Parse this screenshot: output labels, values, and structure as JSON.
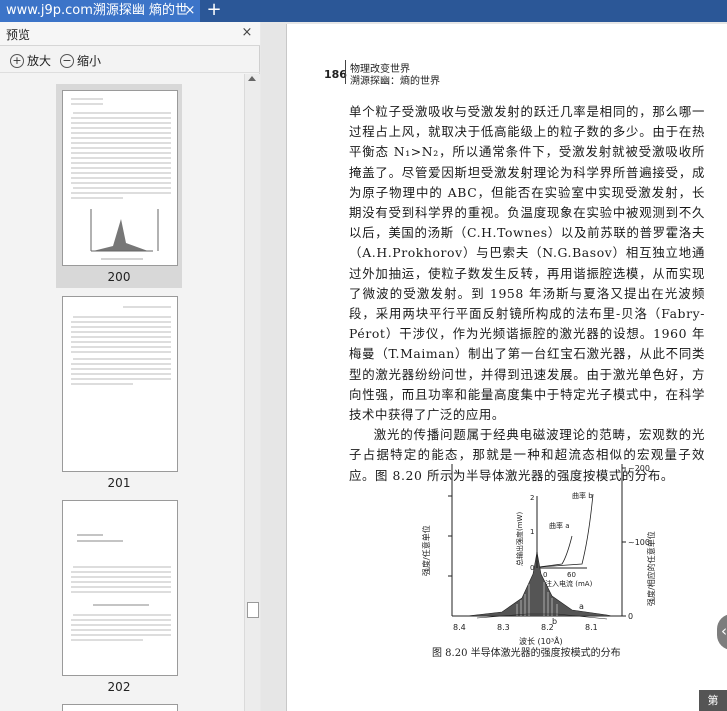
{
  "tab": {
    "title": "www.j9p.com溯源探幽  熵的世",
    "close": "×",
    "add": "+"
  },
  "sidebar": {
    "title": "预览",
    "close": "×",
    "zoom_in_label": "放大",
    "zoom_out_label": "缩小",
    "thumbnails": [
      {
        "label": "200",
        "selected": true
      },
      {
        "label": "201",
        "selected": false
      },
      {
        "label": "202",
        "selected": false
      }
    ]
  },
  "page": {
    "number": "186",
    "header_line1": "物理改变世界",
    "header_line2": "溯源探幽：熵的世界",
    "paragraphs": [
      "单个粒子受激吸收与受激发射的跃迁几率是相同的，那么哪一过程占上风，就取决于低高能级上的粒子数的多少。由于在热平衡态 N₁>N₂，所以通常条件下，受激发射就被受激吸收所掩盖了。尽管爱因斯坦受激发射理论为科学界所普遍接受，成为原子物理中的 ABC，但能否在实验室中实现受激发射，长期没有受到科学界的重视。负温度现象在实验中被观测到不久以后，美国的汤斯（C.H.Townes）以及前苏联的普罗霍洛夫（A.H.Prokhorov）与巴索夫（N.G.Basov）相互独立地通过外加抽运，使粒子数发生反转，再用谐振腔选模，从而实现了微波的受激发射。到 1958 年汤斯与夏洛又提出在光波频段，采用两块平行平面反射镜所构成的法布里-贝洛（Fabry-Pérot）干涉仪，作为光频谐振腔的激光器的设想。1960 年梅曼（T.Maiman）制出了第一台红宝石激光器，从此不同类型的激光器纷纷问世，并得到迅速发展。由于激光单色好，方向性强，而且功率和能量高度集中于特定光子模式中，在科学技术中获得了广泛的应用。",
      "激光的传播问题属于经典电磁波理论的范畴，宏观数的光子占据特定的能态，那就是一种和超流态相似的宏观量子效应。图 8.20 所示为半导体激光器的强度按模式的分布。"
    ],
    "figure": {
      "left_axis_label": "强度/任意单位",
      "right_axis_label": "强度/相应的任意单位",
      "inset_y_label": "总输出强度(mW)",
      "inset_x_label": "注入电流 (mA)",
      "inset_ticks_y": [
        "2",
        "1",
        "0"
      ],
      "inset_ticks_x": [
        "0",
        "60"
      ],
      "right_ticks": [
        "~200",
        "~100",
        "0"
      ],
      "curve_a": "曲率 a",
      "curve_b": "曲率 b",
      "x_ticks": [
        "8.4",
        "8.3",
        "8.2",
        "8.1"
      ],
      "x_label": "波长 (10³Å)",
      "label_a": "a",
      "label_b": "b",
      "caption": "图 8.20  半导体激光器的强度按模式的分布"
    }
  },
  "overlay": {
    "fab_icon": "chevron-left-icon",
    "corner_badge": "第"
  }
}
